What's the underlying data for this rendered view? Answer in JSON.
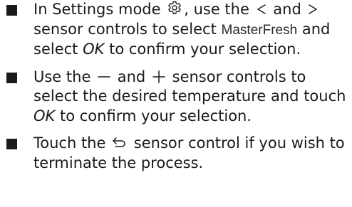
{
  "instructions": [
    {
      "t1": "In Settings mode",
      "settings_icon": "gear-icon",
      "t2": ", use the",
      "prev_icon": "chevron-left-icon",
      "t3": "and",
      "next_icon": "chevron-right-icon",
      "t4": "sensor controls to select",
      "display_value": "MasterFresh",
      "t5": "and select",
      "em1": "OK",
      "t6": "to confirm your selection."
    },
    {
      "t1": "Use the",
      "minus_icon": "minus-icon",
      "t2": "and",
      "plus_icon": "plus-icon",
      "t3": "sensor controls to select the desired temperature and touch",
      "em1": "OK",
      "t4": "to confirm your selection."
    },
    {
      "t1": "Touch the",
      "back_icon": "back-arrow-icon",
      "t2": "sensor control if you wish to terminate the process."
    }
  ]
}
